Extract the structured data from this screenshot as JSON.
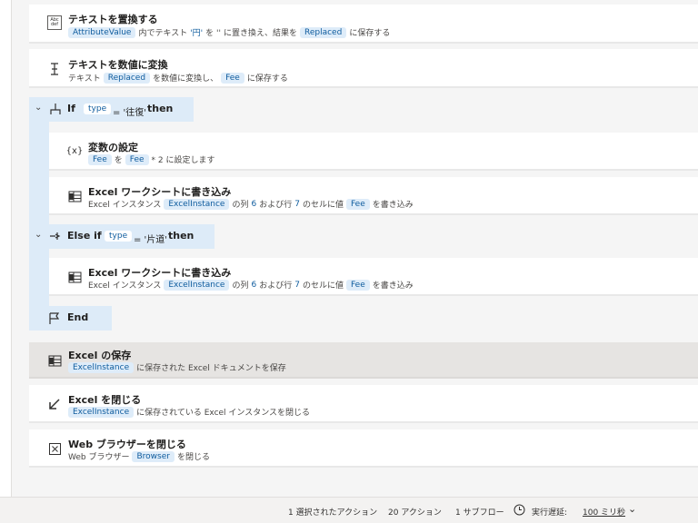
{
  "actions": {
    "replace_text": {
      "title": "テキストを置換する",
      "tok1": "AttributeValue",
      "t1": "内でテキスト",
      "q1": "'円'",
      "t2": "を ''",
      "t3": "に置き換え、結果を",
      "tok2": "Replaced",
      "t4": "に保存する"
    },
    "text_to_number": {
      "title": "テキストを数値に変換",
      "t1": "テキスト",
      "tok1": "Replaced",
      "t2": "を数値に変換し、",
      "tok2": "Fee",
      "t3": "に保存する"
    },
    "if": {
      "keyword": "If",
      "var": "type",
      "expr": "= '往復'",
      "then": "then"
    },
    "set_variable": {
      "title": "変数の設定",
      "tok1": "Fee",
      "t1": "を",
      "tok2": "Fee",
      "t2": "* 2 に設定します"
    },
    "excel_write1": {
      "title": "Excel ワークシートに書き込み",
      "t1": "Excel インスタンス",
      "tok1": "ExcelInstance",
      "t2": "の列",
      "n1": "6",
      "t3": "および行",
      "n2": "7",
      "t4": "のセルに値",
      "tok2": "Fee",
      "t5": "を書き込み"
    },
    "else_if": {
      "keyword": "Else if",
      "var": "type",
      "expr": "= '片道'",
      "then": "then"
    },
    "excel_write2": {
      "title": "Excel ワークシートに書き込み",
      "t1": "Excel インスタンス",
      "tok1": "ExcelInstance",
      "t2": "の列",
      "n1": "6",
      "t3": "および行",
      "n2": "7",
      "t4": "のセルに値",
      "tok2": "Fee",
      "t5": "を書き込み"
    },
    "end": {
      "keyword": "End"
    },
    "excel_save": {
      "title": "Excel の保存",
      "tok1": "ExcelInstance",
      "t1": "に保存された Excel ドキュメントを保存"
    },
    "excel_close": {
      "title": "Excel を閉じる",
      "tok1": "ExcelInstance",
      "t1": "に保存されている Excel インスタンスを閉じる"
    },
    "close_browser": {
      "title": "Web ブラウザーを閉じる",
      "t1": "Web ブラウザー",
      "tok1": "Browser",
      "t2": "を閉じる"
    }
  },
  "status": {
    "selected": "1 選択されたアクション",
    "actions": "20 アクション",
    "subflows": "1 サブフロー",
    "delay_label": "実行遅延:",
    "delay_value": "100 ミリ秒"
  },
  "icons": {
    "abc": "abc-replace-icon",
    "num": "text-number-icon",
    "excel": "excel-icon"
  }
}
